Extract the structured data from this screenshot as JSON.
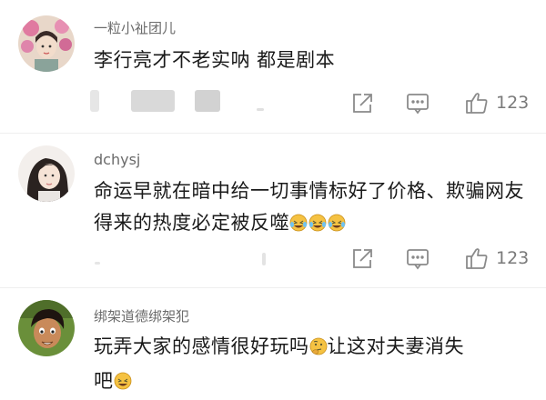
{
  "comments": [
    {
      "username": "一粒小祉团儿",
      "text": "李行亮才不老实呐 都是剧本",
      "likes": "123"
    },
    {
      "username": "dchysj",
      "text": "命运早就在暗中给一切事情标好了价格、欺骗网友得来的热度必定被反噬",
      "likes": "123"
    },
    {
      "username": "绑架道德绑架犯",
      "text": "玩弄大家的感情很好玩吗",
      "text2": "让这对夫妻消失",
      "text3": "吧"
    }
  ],
  "icons": {
    "share": "share-icon",
    "comment": "comment-icon",
    "like": "thumbs-up-icon",
    "emoji_laugh": "laughing-crying-emoji",
    "emoji_think": "thinking-emoji"
  }
}
